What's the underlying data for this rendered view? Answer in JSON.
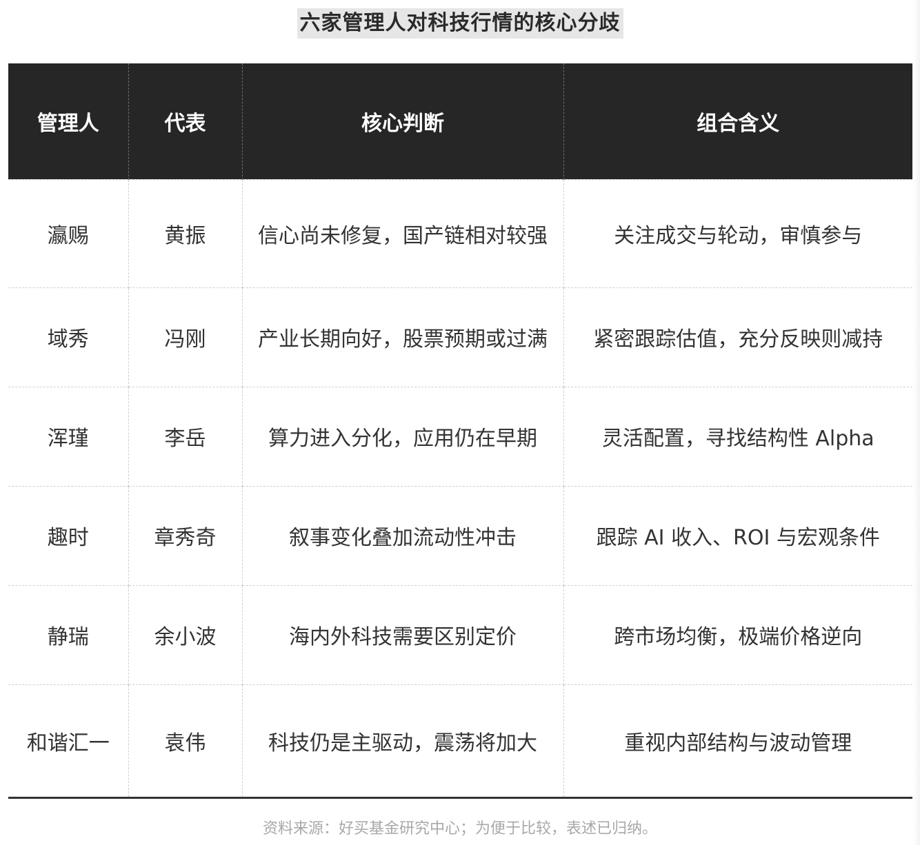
{
  "title": "六家管理人对科技行情的核心分歧",
  "table": {
    "headers": [
      "管理人",
      "代表",
      "核心判断",
      "组合含义"
    ],
    "rows": [
      {
        "manager": "瀛赐",
        "representative": "黄振",
        "judgment": "信心尚未修复，国产链相对较强",
        "implication": "关注成交与轮动，审慎参与"
      },
      {
        "manager": "域秀",
        "representative": "冯刚",
        "judgment": "产业长期向好，股票预期或过满",
        "implication": "紧密跟踪估值，充分反映则减持"
      },
      {
        "manager": "浑瑾",
        "representative": "李岳",
        "judgment": "算力进入分化，应用仍在早期",
        "implication": "灵活配置，寻找结构性 Alpha"
      },
      {
        "manager": "趣时",
        "representative": "章秀奇",
        "judgment": "叙事变化叠加流动性冲击",
        "implication": "跟踪 AI 收入、ROI 与宏观条件"
      },
      {
        "manager": "静瑞",
        "representative": "余小波",
        "judgment": "海内外科技需要区别定价",
        "implication": "跨市场均衡，极端价格逆向"
      },
      {
        "manager": "和谐汇一",
        "representative": "袁伟",
        "judgment": "科技仍是主驱动，震荡将加大",
        "implication": "重视内部结构与波动管理"
      }
    ]
  },
  "source_note": "资料来源：好买基金研究中心；为便于比较，表述已归纳。"
}
